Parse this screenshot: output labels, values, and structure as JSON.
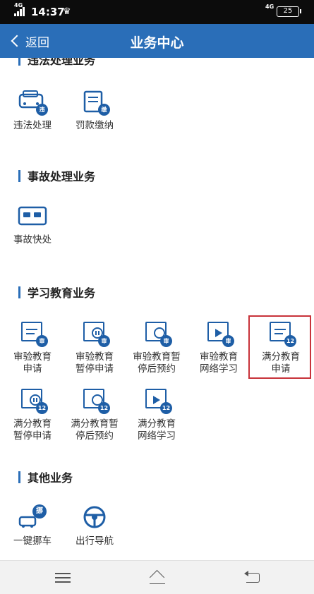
{
  "status_bar": {
    "network_left": "4G",
    "time": "14:37",
    "network_right": "4G",
    "battery": "25"
  },
  "nav": {
    "back_label": "返回",
    "title": "业务中心"
  },
  "sections": [
    {
      "title": "违法处理业务",
      "items": [
        {
          "label": "违法处理",
          "badge": "违",
          "icon": "car-violation-icon"
        },
        {
          "label": "罚款缴纳",
          "badge": "缴",
          "icon": "fine-payment-icon"
        }
      ]
    },
    {
      "title": "事故处理业务",
      "items": [
        {
          "label": "事故快处",
          "icon": "accident-quick-icon"
        }
      ]
    },
    {
      "title": "学习教育业务",
      "items": [
        {
          "label_line1": "审验教育",
          "label_line2": "申请",
          "badge": "审",
          "icon": "document-icon"
        },
        {
          "label_line1": "审验教育",
          "label_line2": "暂停申请",
          "badge": "审",
          "icon": "pause-document-icon"
        },
        {
          "label_line1": "审验教育暂",
          "label_line2": "停后预约",
          "badge": "审",
          "icon": "clock-document-icon"
        },
        {
          "label_line1": "审验教育",
          "label_line2": "网络学习",
          "badge": "审",
          "icon": "video-document-icon"
        },
        {
          "label_line1": "满分教育",
          "label_line2": "申请",
          "badge": "12",
          "icon": "document-icon"
        },
        {
          "label_line1": "满分教育",
          "label_line2": "暂停申请",
          "badge": "12",
          "icon": "pause-document-icon"
        },
        {
          "label_line1": "满分教育暂",
          "label_line2": "停后预约",
          "badge": "12",
          "icon": "clock-document-icon"
        },
        {
          "label_line1": "满分教育",
          "label_line2": "网络学习",
          "badge": "12",
          "icon": "video-document-icon"
        }
      ]
    },
    {
      "title": "其他业务",
      "items": [
        {
          "label": "一键挪车",
          "badge": "挪",
          "icon": "move-car-icon"
        },
        {
          "label": "出行导航",
          "icon": "steering-wheel-icon"
        }
      ]
    }
  ],
  "colors": {
    "primary": "#2a6eb8",
    "icon": "#1e5ea6",
    "highlight": "#c8323a"
  }
}
